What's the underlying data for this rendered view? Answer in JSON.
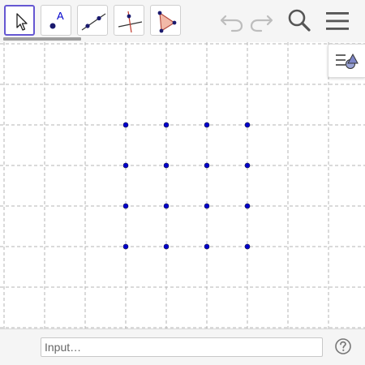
{
  "toolbar": {
    "tools": [
      {
        "name": "move-tool",
        "icon": "arrow-cursor-icon",
        "selected": true
      },
      {
        "name": "point-tool",
        "icon": "point-icon",
        "label": "A",
        "selected": false
      },
      {
        "name": "line-tool",
        "icon": "line-through-two-points-icon",
        "selected": false
      },
      {
        "name": "perpendicular-line-tool",
        "icon": "perpendicular-line-icon",
        "selected": false
      },
      {
        "name": "polygon-tool",
        "icon": "polygon-icon",
        "selected": false
      }
    ],
    "undo_icon": "undo-icon",
    "redo_icon": "redo-icon",
    "search_icon": "search-icon",
    "menu_icon": "hamburger-menu-icon"
  },
  "graphics": {
    "grid_lines": "dashed",
    "point_color": "#0000cc",
    "points": {
      "columns": 4,
      "rows": 4
    },
    "style_bar_icon": "style-bar-toggle-icon"
  },
  "input_bar": {
    "placeholder": "Input…",
    "help_icon": "help-icon"
  },
  "colors": {
    "accent": "#6557d2",
    "toolbar_bg": "#f5f5f5",
    "disabled_icon": "#bdbdbd"
  }
}
